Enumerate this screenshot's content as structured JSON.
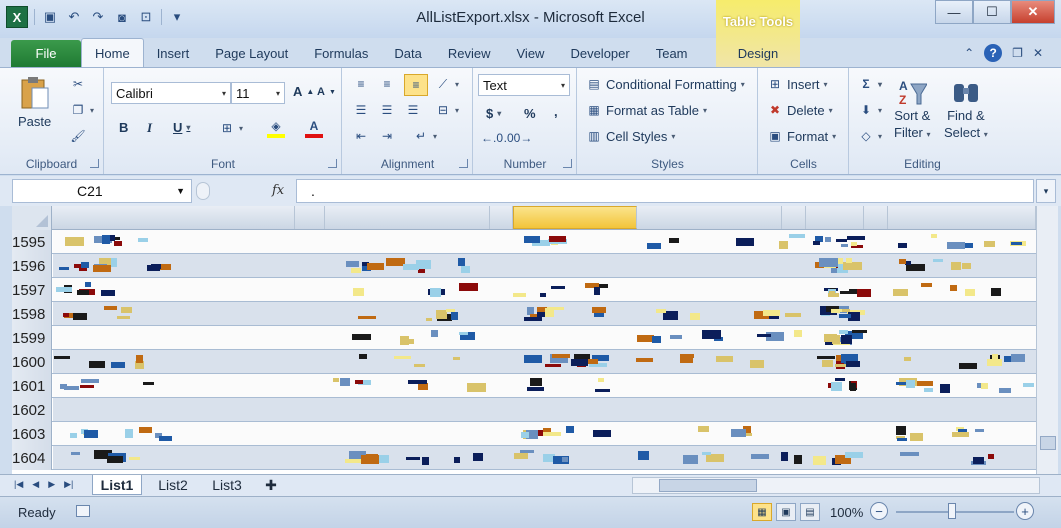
{
  "window": {
    "title": "AllListExport.xlsx  -  Microsoft Excel",
    "contextual_tab_group": "Table Tools",
    "controls": {
      "minimize": "—",
      "maximize": "☐",
      "close": "✕"
    }
  },
  "quick_access": {
    "app_icon": "X",
    "icons": [
      "save-icon",
      "undo-icon",
      "redo-icon",
      "camera-icon",
      "print-preview-icon"
    ]
  },
  "tabs": [
    "File",
    "Home",
    "Insert",
    "Page Layout",
    "Formulas",
    "Data",
    "Review",
    "View",
    "Developer",
    "Team",
    "Design"
  ],
  "active_tab": "Home",
  "ribbon": {
    "clipboard": {
      "label": "Clipboard",
      "paste": "Paste"
    },
    "font": {
      "label": "Font",
      "name": "Calibri",
      "size": "11"
    },
    "alignment": {
      "label": "Alignment"
    },
    "number": {
      "label": "Number",
      "format": "Text",
      "dollar": "$",
      "percent": "%",
      "comma": ","
    },
    "styles": {
      "label": "Styles",
      "conditional": "Conditional Formatting",
      "format_table": "Format as Table",
      "cell_styles": "Cell Styles"
    },
    "cells": {
      "label": "Cells",
      "insert": "Insert",
      "delete": "Delete",
      "format": "Format"
    },
    "editing": {
      "label": "Editing",
      "sort_line1": "Sort &",
      "sort_line2": "Filter",
      "find_line1": "Find &",
      "find_line2": "Select"
    }
  },
  "formula_bar": {
    "name_box": "C21",
    "fx": "fx",
    "content": "."
  },
  "rows": [
    "1595",
    "1596",
    "1597",
    "1598",
    "1599",
    "1600",
    "1601",
    "1602",
    "1603",
    "1604"
  ],
  "sheets": [
    "List1",
    "List2",
    "List3"
  ],
  "active_sheet": "List1",
  "status": {
    "ready": "Ready",
    "zoom": "100%"
  },
  "colors": {
    "accent_green": "#1f7a33",
    "selected_header": "#f2c43a",
    "row_band": "#d9e1ec"
  }
}
